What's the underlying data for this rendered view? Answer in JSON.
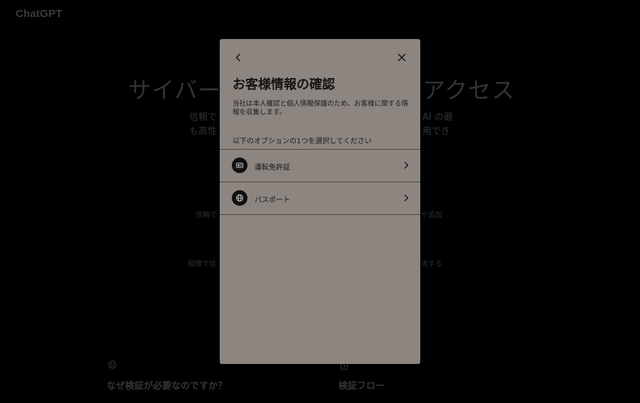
{
  "background": {
    "logo": "ChatGPT",
    "hero_left": "サイバー",
    "hero_right": "アクセス",
    "line1_left": "信頼で",
    "line1_right": "AI の最",
    "line2_left": "も高性",
    "line2_right": "用でき",
    "mid_left": "信頼で",
    "mid_right": "や追加",
    "lower_left": "組織で信",
    "lower_right": "求する",
    "section_left_title": "なぜ検証が必要なのですか？",
    "section_right_title": "検証フロー"
  },
  "modal": {
    "title": "お客様情報の確認",
    "description": "当社は本人確認と個人情報保護のため、お客様に関する情報を収集します。",
    "prompt": "以下のオプションの1つを選択してください",
    "options": [
      {
        "label": "運転免許証",
        "icon": "id-card-icon"
      },
      {
        "label": "パスポート",
        "icon": "globe-icon"
      }
    ]
  },
  "colors": {
    "page_bg": "#000000",
    "modal_bg": "#8c8580",
    "icon_circle": "#111111"
  }
}
